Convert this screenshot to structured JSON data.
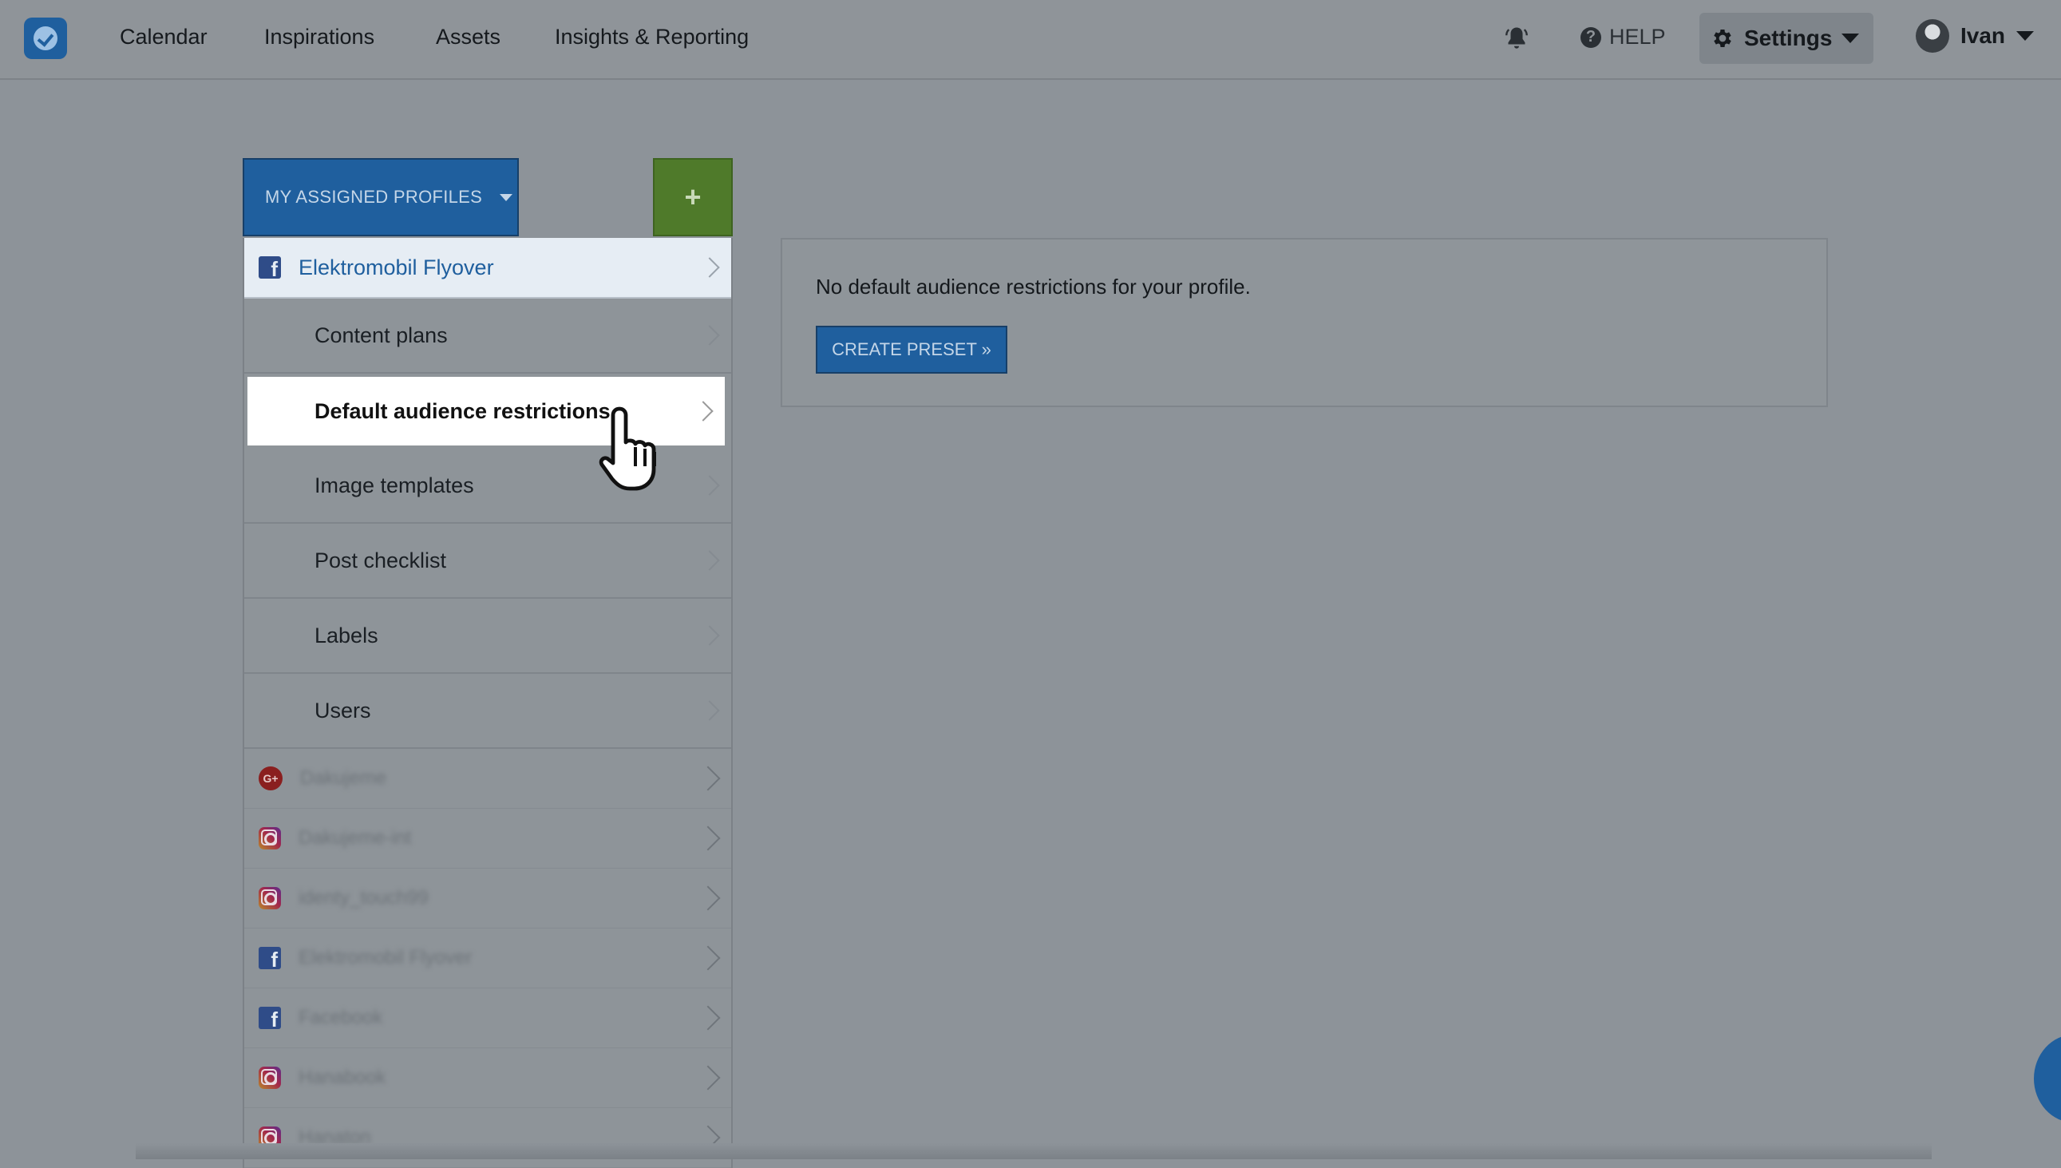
{
  "header": {
    "nav": [
      "Calendar",
      "Inspirations",
      "Assets",
      "Insights & Reporting"
    ],
    "help_label": "HELP",
    "settings_label": "Settings",
    "user_name": "Ivan"
  },
  "sidebar": {
    "profiles_button_label": "MY ASSIGNED PROFILES",
    "add_button_label": "+",
    "selected_profile": {
      "network": "facebook",
      "name": "Elektromobil Flyover"
    },
    "profile_menu": [
      {
        "label": "Content plans",
        "active": false
      },
      {
        "label": "Default audience restrictions",
        "active": true
      },
      {
        "label": "Image templates",
        "active": false
      },
      {
        "label": "Post checklist",
        "active": false
      },
      {
        "label": "Labels",
        "active": false
      },
      {
        "label": "Users",
        "active": false
      }
    ],
    "other_profiles": [
      {
        "network": "google-plus",
        "name": "Dakujeme"
      },
      {
        "network": "instagram",
        "name": "Dakujeme-int"
      },
      {
        "network": "instagram",
        "name": "identy_touch99"
      },
      {
        "network": "facebook",
        "name": "Elektromobil Flyover"
      },
      {
        "network": "facebook",
        "name": "Facebook"
      },
      {
        "network": "instagram",
        "name": "Hanabook"
      },
      {
        "network": "instagram",
        "name": "Hanaton"
      }
    ]
  },
  "main": {
    "message": "No default audience restrictions for your profile.",
    "create_button_label": "CREATE PRESET »"
  },
  "colors": {
    "primary": "#1f5f9e",
    "add_button": "#4f7a2a",
    "overlay": "#8d9399"
  }
}
